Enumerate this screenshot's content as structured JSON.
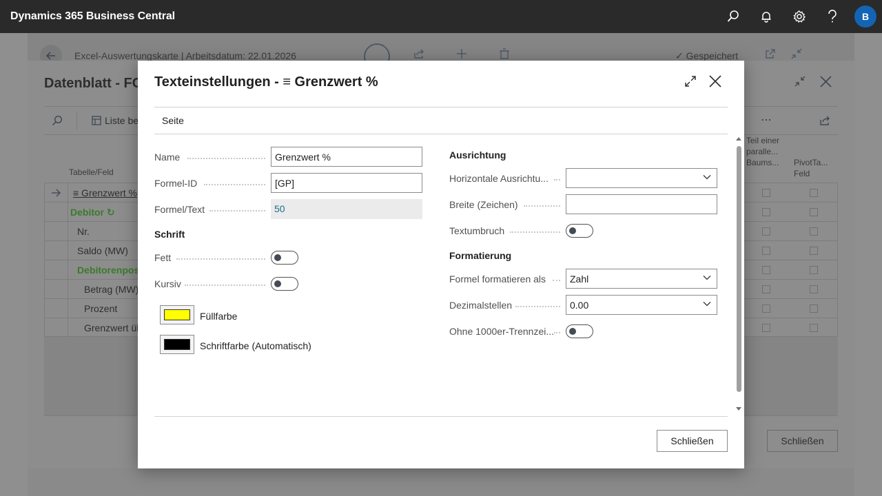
{
  "app": {
    "title": "Dynamics 365 Business Central",
    "avatar_initial": "B"
  },
  "background_page": {
    "title": "Excel-Auswertungskarte | Arbeitsdatum: 22.01.2026",
    "saved_status": "Gespeichert"
  },
  "datasheet": {
    "title": "Datenblatt - FC",
    "action_list": "Liste be",
    "column_table_field": "Tabelle/Feld",
    "column_part_of_tree": "Teil einer paralle... Baums...",
    "column_pivot": "PivotTa... Feld",
    "rows": [
      {
        "label": "≡ Grenzwert %"
      },
      {
        "label": "Debitor ↻"
      },
      {
        "label": "Nr."
      },
      {
        "label": "Saldo (MW)"
      },
      {
        "label": "Debitorenpos"
      },
      {
        "label": "Betrag (MW)"
      },
      {
        "label": "Prozent"
      },
      {
        "label": "Grenzwert üb"
      }
    ],
    "close_label": "Schließen"
  },
  "dialog": {
    "title": "Texteinstellungen - ≡ Grenzwert %",
    "tab_label": "Seite",
    "left": {
      "name_label": "Name",
      "name_value": "Grenzwert %",
      "formula_id_label": "Formel-ID",
      "formula_id_value": "[GP]",
      "formula_text_label": "Formel/Text",
      "formula_text_value": "50",
      "font_section": "Schrift",
      "bold_label": "Fett",
      "bold_on": false,
      "italic_label": "Kursiv",
      "italic_on": false,
      "fill_color_label": "Füllfarbe",
      "fill_color": "#ffff00",
      "font_color_label": "Schriftfarbe (Automatisch)",
      "font_color": "#000000"
    },
    "right": {
      "alignment_section": "Ausrichtung",
      "horizontal_label": "Horizontale Ausrichtu...",
      "horizontal_value": "",
      "width_label": "Breite (Zeichen)",
      "width_value": "",
      "wrap_label": "Textumbruch",
      "wrap_on": false,
      "formatting_section": "Formatierung",
      "format_as_label": "Formel formatieren als",
      "format_as_value": "Zahl",
      "decimals_label": "Dezimalstellen",
      "decimals_value": "0.00",
      "no_separator_label": "Ohne 1000er-Trennzei...",
      "no_separator_on": false
    },
    "close_label": "Schließen"
  }
}
